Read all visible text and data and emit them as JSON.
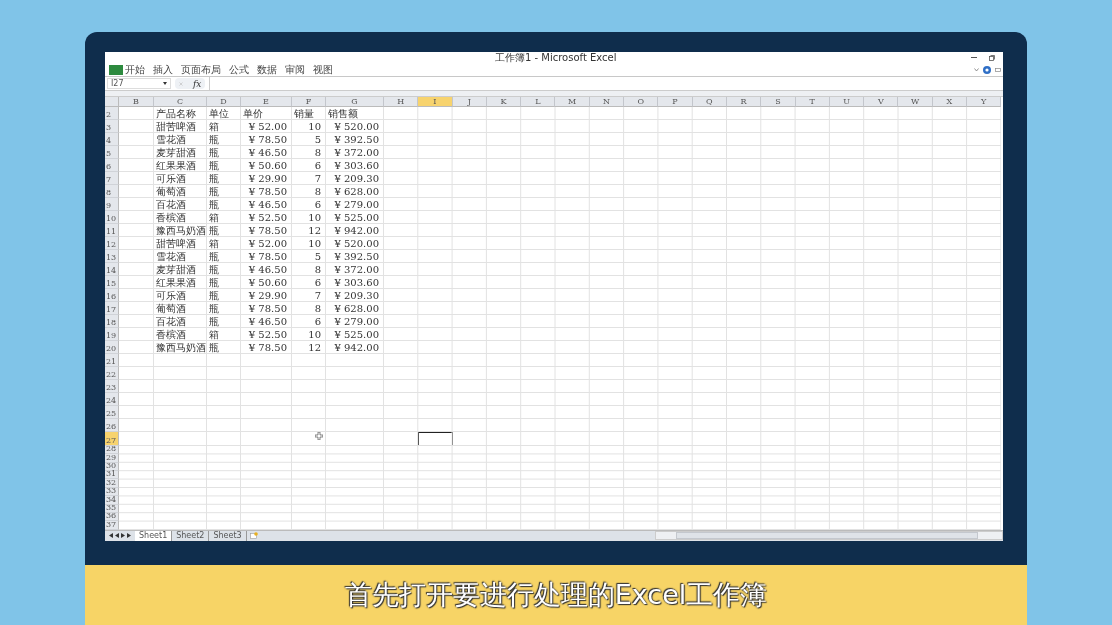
{
  "window": {
    "title": "工作簿1 - Microsoft Excel"
  },
  "ribbon_tabs": [
    {
      "label": "开始",
      "selected": false
    },
    {
      "label": "插入",
      "selected": false
    },
    {
      "label": "页面布局",
      "selected": false
    },
    {
      "label": "公式",
      "selected": false
    },
    {
      "label": "数据",
      "selected": false
    },
    {
      "label": "审阅",
      "selected": false
    },
    {
      "label": "视图",
      "selected": false
    }
  ],
  "formula_bar": {
    "name_box": "I27",
    "fx": "fx"
  },
  "sheet": {
    "columns": [
      {
        "label": "B",
        "selected": false
      },
      {
        "label": "C",
        "selected": false
      },
      {
        "label": "D",
        "selected": false
      },
      {
        "label": "E",
        "selected": false
      },
      {
        "label": "F",
        "selected": false
      },
      {
        "label": "G",
        "selected": false
      },
      {
        "label": "H",
        "selected": false
      },
      {
        "label": "I",
        "selected": true
      },
      {
        "label": "J",
        "selected": false
      },
      {
        "label": "K",
        "selected": false
      },
      {
        "label": "L",
        "selected": false
      },
      {
        "label": "M",
        "selected": false
      },
      {
        "label": "N",
        "selected": false
      },
      {
        "label": "O",
        "selected": false
      },
      {
        "label": "P",
        "selected": false
      },
      {
        "label": "Q",
        "selected": false
      },
      {
        "label": "R",
        "selected": false
      },
      {
        "label": "S",
        "selected": false
      },
      {
        "label": "T",
        "selected": false
      },
      {
        "label": "U",
        "selected": false
      },
      {
        "label": "V",
        "selected": false
      },
      {
        "label": "W",
        "selected": false
      },
      {
        "label": "X",
        "selected": false
      },
      {
        "label": "Y",
        "selected": false
      }
    ],
    "header_row": {
      "row": "2",
      "product": "产品名称",
      "unit": "单位",
      "price": "单价",
      "qty": "销量",
      "total": "销售额"
    },
    "rows": [
      {
        "row": "3",
        "selected": false,
        "product": "甜苦啤酒",
        "unit": "箱",
        "price": "¥ 52.00",
        "qty": "10",
        "total": "¥ 520.00"
      },
      {
        "row": "4",
        "selected": false,
        "product": "雪花酒",
        "unit": "瓶",
        "price": "¥ 78.50",
        "qty": "5",
        "total": "¥ 392.50"
      },
      {
        "row": "5",
        "selected": false,
        "product": "麦芽甜酒",
        "unit": "瓶",
        "price": "¥ 46.50",
        "qty": "8",
        "total": "¥ 372.00"
      },
      {
        "row": "6",
        "selected": false,
        "product": "红果果酒",
        "unit": "瓶",
        "price": "¥ 50.60",
        "qty": "6",
        "total": "¥ 303.60"
      },
      {
        "row": "7",
        "selected": false,
        "product": "可乐酒",
        "unit": "瓶",
        "price": "¥ 29.90",
        "qty": "7",
        "total": "¥ 209.30"
      },
      {
        "row": "8",
        "selected": false,
        "product": "葡萄酒",
        "unit": "瓶",
        "price": "¥ 78.50",
        "qty": "8",
        "total": "¥ 628.00"
      },
      {
        "row": "9",
        "selected": false,
        "product": "百花酒",
        "unit": "瓶",
        "price": "¥ 46.50",
        "qty": "6",
        "total": "¥ 279.00"
      },
      {
        "row": "10",
        "selected": false,
        "product": "香槟酒",
        "unit": "箱",
        "price": "¥ 52.50",
        "qty": "10",
        "total": "¥ 525.00"
      },
      {
        "row": "11",
        "selected": false,
        "product": "豫西马奶酒",
        "unit": "瓶",
        "price": "¥ 78.50",
        "qty": "12",
        "total": "¥ 942.00"
      },
      {
        "row": "12",
        "selected": false,
        "product": "甜苦啤酒",
        "unit": "箱",
        "price": "¥ 52.00",
        "qty": "10",
        "total": "¥ 520.00"
      },
      {
        "row": "13",
        "selected": false,
        "product": "雪花酒",
        "unit": "瓶",
        "price": "¥ 78.50",
        "qty": "5",
        "total": "¥ 392.50"
      },
      {
        "row": "14",
        "selected": false,
        "product": "麦芽甜酒",
        "unit": "瓶",
        "price": "¥ 46.50",
        "qty": "8",
        "total": "¥ 372.00"
      },
      {
        "row": "15",
        "selected": false,
        "product": "红果果酒",
        "unit": "瓶",
        "price": "¥ 50.60",
        "qty": "6",
        "total": "¥ 303.60"
      },
      {
        "row": "16",
        "selected": false,
        "product": "可乐酒",
        "unit": "瓶",
        "price": "¥ 29.90",
        "qty": "7",
        "total": "¥ 209.30"
      },
      {
        "row": "17",
        "selected": false,
        "product": "葡萄酒",
        "unit": "瓶",
        "price": "¥ 78.50",
        "qty": "8",
        "total": "¥ 628.00"
      },
      {
        "row": "18",
        "selected": false,
        "product": "百花酒",
        "unit": "瓶",
        "price": "¥ 46.50",
        "qty": "6",
        "total": "¥ 279.00"
      },
      {
        "row": "19",
        "selected": false,
        "product": "香槟酒",
        "unit": "箱",
        "price": "¥ 52.50",
        "qty": "10",
        "total": "¥ 525.00"
      },
      {
        "row": "20",
        "selected": false,
        "product": "豫西马奶酒",
        "unit": "瓶",
        "price": "¥ 78.50",
        "qty": "12",
        "total": "¥ 942.00"
      },
      {
        "row": "21",
        "selected": false
      },
      {
        "row": "22",
        "selected": false
      },
      {
        "row": "23",
        "selected": false
      },
      {
        "row": "24",
        "selected": false
      },
      {
        "row": "25",
        "selected": false
      },
      {
        "row": "26",
        "selected": false
      },
      {
        "row": "27",
        "selected": true
      },
      {
        "row": "28",
        "selected": false
      },
      {
        "row": "29",
        "selected": false
      },
      {
        "row": "30",
        "selected": false
      },
      {
        "row": "31",
        "selected": false
      },
      {
        "row": "32",
        "selected": false
      },
      {
        "row": "33",
        "selected": false
      },
      {
        "row": "34",
        "selected": false
      },
      {
        "row": "35",
        "selected": false
      },
      {
        "row": "36",
        "selected": false
      },
      {
        "row": "37",
        "selected": false
      }
    ]
  },
  "sheet_tabs": [
    {
      "label": "Sheet1",
      "selected": true
    },
    {
      "label": "Sheet2",
      "selected": false
    },
    {
      "label": "Sheet3",
      "selected": false
    }
  ],
  "caption": "首先打开要进行处理的Excel工作簿"
}
